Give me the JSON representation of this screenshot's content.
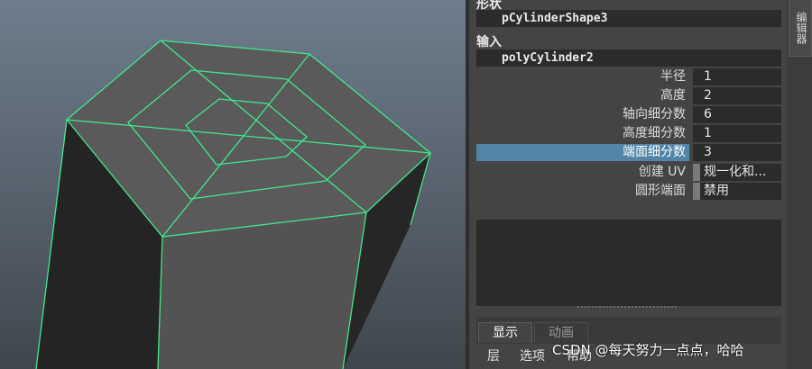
{
  "inspector": {
    "side_tab_label": "编辑器",
    "shape_section_label": "形状",
    "shape_node": "pCylinderShape3",
    "input_section_label": "输入",
    "input_node": "polyCylinder2",
    "attributes": [
      {
        "label": "半径",
        "value": "1"
      },
      {
        "label": "高度",
        "value": "2"
      },
      {
        "label": "轴向细分数",
        "value": "6"
      },
      {
        "label": "高度细分数",
        "value": "1"
      },
      {
        "label": "端面细分数",
        "value": "3",
        "selected": true
      },
      {
        "label": "创建 UV",
        "value": "规一化和..."
      },
      {
        "label": "圆形端面",
        "value": "禁用"
      }
    ],
    "tabs": [
      {
        "label": "显示",
        "active": true
      },
      {
        "label": "动画",
        "active": false
      }
    ],
    "menu": [
      "层",
      "选项",
      "帮助"
    ]
  },
  "viewport": {
    "wire_color": "#3fe88e",
    "top_face_color": "#5a5a5a",
    "side_dark_color": "#262626"
  },
  "watermark": "CSDN @每天努力一点点，哈哈",
  "colors": {
    "selection": "#5285a6",
    "panel_bg": "#444444",
    "field_bg": "#2b2b2b"
  }
}
